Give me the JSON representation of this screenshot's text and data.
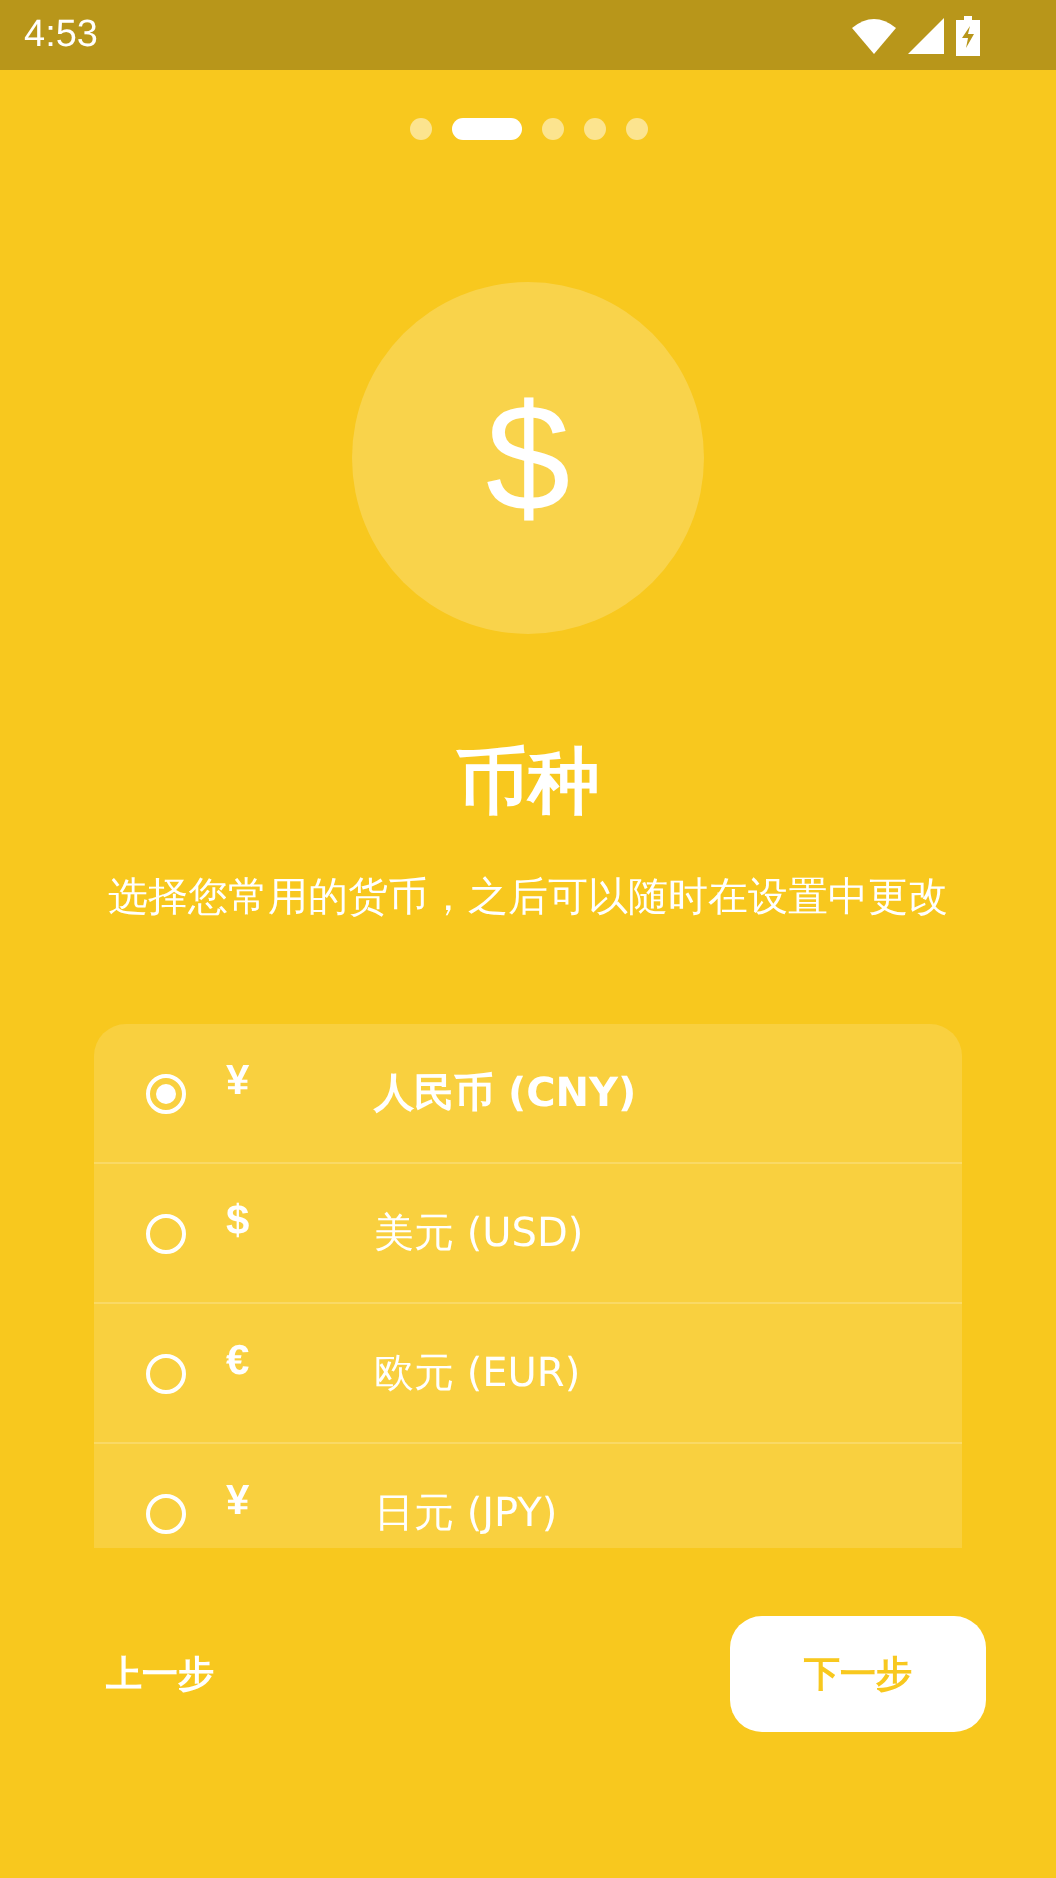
{
  "status_bar": {
    "time": "4:53"
  },
  "pager": [
    {
      "selected": false
    },
    {
      "selected": true
    },
    {
      "selected": false
    },
    {
      "selected": false
    },
    {
      "selected": false
    }
  ],
  "hero": {
    "symbol": "$"
  },
  "title": "币种",
  "subtitle": "选择您常用的货币，之后可以随时在设置中更改",
  "currencies": [
    {
      "symbol": "¥",
      "name": "人民币 (CNY)",
      "selected": true
    },
    {
      "symbol": "$",
      "name": "美元 (USD)",
      "selected": false
    },
    {
      "symbol": "€",
      "name": "欧元 (EUR)",
      "selected": false
    },
    {
      "symbol": "¥",
      "name": "日元 (JPY)",
      "selected": false
    }
  ],
  "buttons": {
    "back": "上一步",
    "next": "下一步"
  }
}
